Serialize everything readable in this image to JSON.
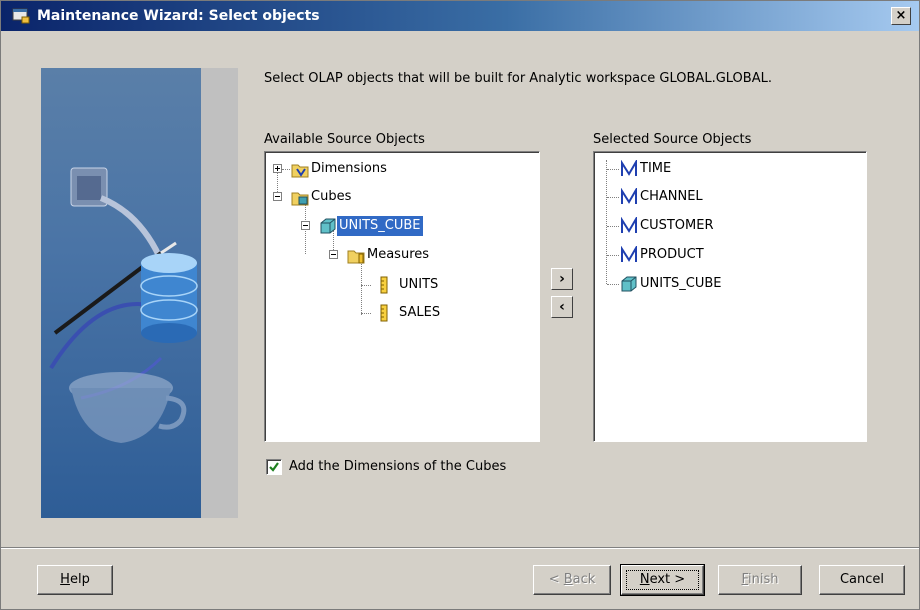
{
  "window": {
    "title": "Maintenance Wizard: Select objects",
    "close_label": "×"
  },
  "instruction": "Select OLAP objects that will be built for Analytic workspace GLOBAL.GLOBAL.",
  "available": {
    "label": "Available Source Objects",
    "tree": {
      "dimensions": "Dimensions",
      "cubes": "Cubes",
      "units_cube": "UNITS_CUBE",
      "measures": "Measures",
      "units": "UNITS",
      "sales": "SALES"
    }
  },
  "selected": {
    "label": "Selected Source Objects",
    "items": [
      "TIME",
      "CHANNEL",
      "CUSTOMER",
      "PRODUCT",
      "UNITS_CUBE"
    ]
  },
  "move_buttons": {
    "add": "›",
    "remove": "‹"
  },
  "add_dimensions": {
    "label": "Add the Dimensions of the Cubes",
    "checked": true
  },
  "buttons": {
    "help": {
      "first": "H",
      "rest": "elp"
    },
    "back": {
      "pre": "< ",
      "mn": "B",
      "rest": "ack"
    },
    "next": {
      "mn": "N",
      "rest": "ext >"
    },
    "finish": {
      "mn": "F",
      "rest": "inish"
    },
    "cancel": "Cancel"
  },
  "colors": {
    "title_bar": "#0a246a",
    "selection": "#316ac5",
    "window_bg": "#d4d0c8"
  }
}
